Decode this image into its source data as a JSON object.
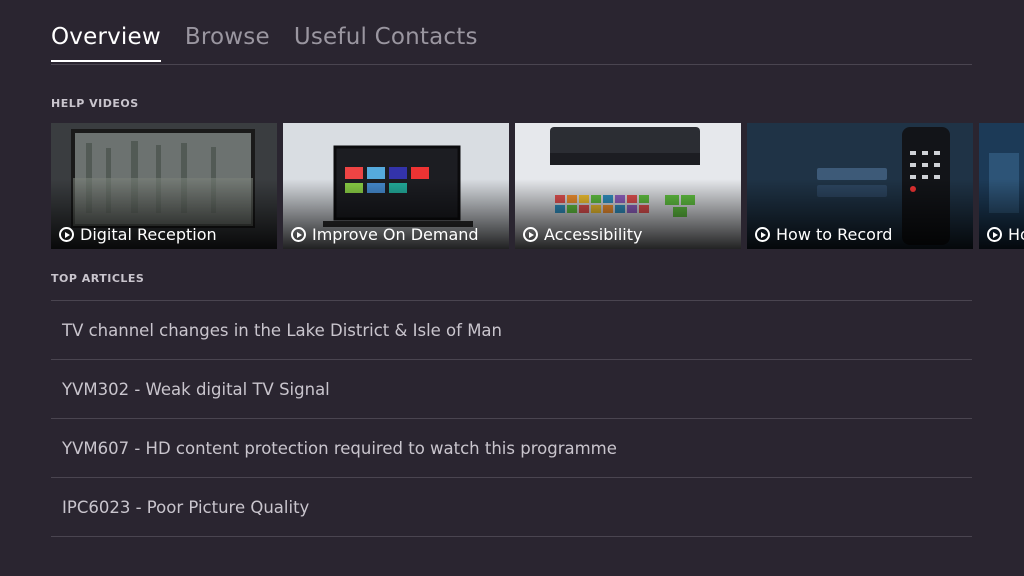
{
  "tabs": [
    {
      "label": "Overview",
      "active": true
    },
    {
      "label": "Browse",
      "active": false
    },
    {
      "label": "Useful Contacts",
      "active": false
    }
  ],
  "help_videos": {
    "title": "HELP VIDEOS",
    "items": [
      {
        "label": "Digital Reception",
        "icon": "play-icon"
      },
      {
        "label": "Improve On Demand",
        "icon": "play-icon"
      },
      {
        "label": "Accessibility",
        "icon": "play-icon"
      },
      {
        "label": "How to Record",
        "icon": "play-icon"
      },
      {
        "label": "Ho",
        "icon": "play-icon"
      }
    ]
  },
  "top_articles": {
    "title": "TOP ARTICLES",
    "items": [
      "TV channel changes in the Lake District & Isle of Man",
      "YVM302 - Weak digital TV Signal",
      "YVM607 - HD content protection required to watch this programme",
      "IPC6023 - Poor Picture Quality"
    ]
  },
  "colors": {
    "background": "#2a2530",
    "text_primary": "#ffffff",
    "text_secondary": "#c9c5cd",
    "divider": "#4a4550"
  }
}
